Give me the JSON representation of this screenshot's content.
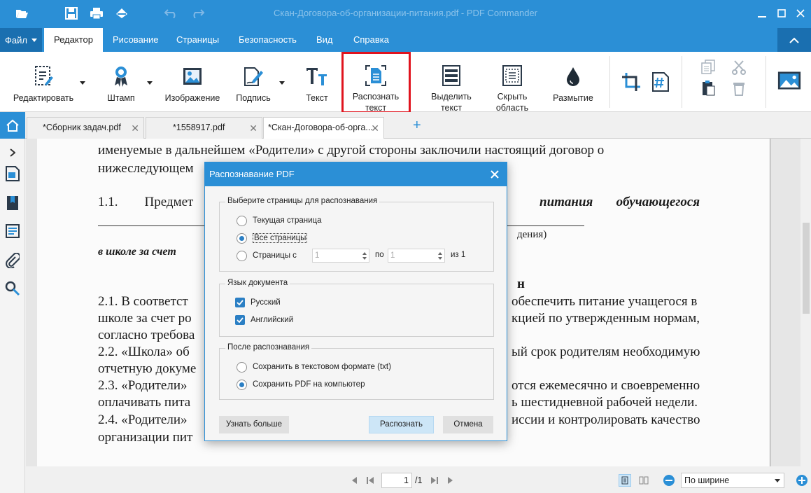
{
  "window": {
    "title": "Скан-Договора-об-организации-питания.pdf - PDF Commander"
  },
  "menu": {
    "file": "Файл",
    "tabs": [
      "Редактор",
      "Рисование",
      "Страницы",
      "Безопасность",
      "Вид",
      "Справка"
    ],
    "active_tab": "Редактор"
  },
  "ribbon": {
    "edit": "Редактировать",
    "stamp": "Штамп",
    "image": "Изображение",
    "signature": "Подпись",
    "text": "Текст",
    "recognize_1": "Распознать",
    "recognize_2": "текст",
    "select_text_1": "Выделить",
    "select_text_2": "текст",
    "hide_area_1": "Скрыть",
    "hide_area_2": "область",
    "blur": "Размытие"
  },
  "tabs": [
    {
      "label": "*Сборник задач.pdf"
    },
    {
      "label": "*1558917.pdf"
    },
    {
      "label": "*Скан-Договора-об-орга..."
    }
  ],
  "document": {
    "lines": [
      "именуемые в дальнейшем «Родители» с другой стороны заключили настоящий договор о",
      "нижеследующем",
      "1.1.        Предмет",
      "питания       обучающегося",
      "дения)",
      "в школе за счет",
      "н",
      "2.1. В соответст",
      "обеспечить питание учащегося в",
      "школе за счет ро",
      "кцией по утвержденным нормам,",
      "согласно требова",
      "2.2. «Школа» об",
      "ый срок родителям необходимую",
      "отчетную докуме",
      "2.3. «Родители»",
      "отся ежемесячно и своевременно",
      "оплачивать пита",
      "ь шестидневной рабочей недели.",
      "2.4. «Родители»",
      "иссии и контролировать качество",
      "организации пит"
    ]
  },
  "statusbar": {
    "current_page": "1",
    "total_pages": "/1",
    "zoom": "По ширине"
  },
  "dialog": {
    "title": "Распознавание PDF",
    "pages_group": {
      "title": "Выберите страницы для распознавания",
      "current": "Текущая страница",
      "all": "Все страницы",
      "range": "Страницы с",
      "from": "1",
      "to_label": "по",
      "to": "1",
      "of": "из 1",
      "selected": "all"
    },
    "language_group": {
      "title": "Язык документа",
      "russian": "Русский",
      "english": "Английский"
    },
    "after_group": {
      "title": "После распознавания",
      "save_txt": "Сохранить в текстовом формате (txt)",
      "save_pdf": "Сохранить PDF на компьютер",
      "selected": "save_pdf"
    },
    "buttons": {
      "learn_more": "Узнать больше",
      "recognize": "Распознать",
      "cancel": "Отмена"
    }
  },
  "colors": {
    "accent": "#2b8fd6",
    "highlight": "#e0141e"
  }
}
